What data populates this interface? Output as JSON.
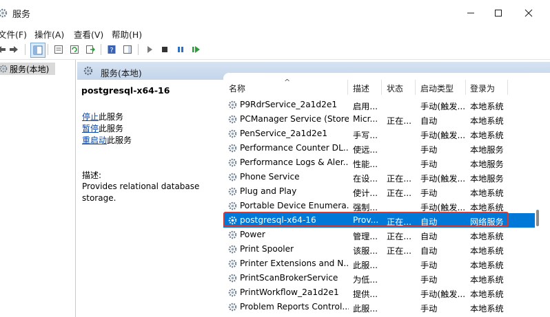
{
  "window": {
    "title": "服务"
  },
  "menu": {
    "file": "文件(F)",
    "action": "操作(A)",
    "view": "查看(V)",
    "help": "帮助(H)"
  },
  "tree": {
    "root_label": "服务(本地)"
  },
  "header": {
    "title": "服务(本地)"
  },
  "detail": {
    "service_name": "postgresql-x64-16",
    "stop_link": "停止",
    "stop_suffix": "此服务",
    "pause_link": "暂停",
    "pause_suffix": "此服务",
    "restart_link": "重启动",
    "restart_suffix": "此服务",
    "desc_label": "描述:",
    "desc_text": "Provides relational database storage."
  },
  "columns": {
    "name": "名称",
    "desc": "描述",
    "status": "状态",
    "startup": "启动类型",
    "logon": "登录为"
  },
  "rows": [
    {
      "name": "P9RdrService_2a1d2e1",
      "desc": "启用...",
      "status": "",
      "startup": "手动(触发...",
      "logon": "本地系统"
    },
    {
      "name": "PCManager Service (Store)",
      "desc": "Micr...",
      "status": "正在...",
      "startup": "自动",
      "logon": "本地系统"
    },
    {
      "name": "PenService_2a1d2e1",
      "desc": "手写...",
      "status": "",
      "startup": "手动(触发...",
      "logon": "本地系统"
    },
    {
      "name": "Performance Counter DL...",
      "desc": "使远...",
      "status": "",
      "startup": "手动",
      "logon": "本地服务"
    },
    {
      "name": "Performance Logs & Aler...",
      "desc": "性能...",
      "status": "",
      "startup": "手动",
      "logon": "本地服务"
    },
    {
      "name": "Phone Service",
      "desc": "在设...",
      "status": "正在...",
      "startup": "手动(触发...",
      "logon": "本地服务"
    },
    {
      "name": "Plug and Play",
      "desc": "使计...",
      "status": "正在...",
      "startup": "手动",
      "logon": "本地系统"
    },
    {
      "name": "Portable Device Enumera...",
      "desc": "强制...",
      "status": "",
      "startup": "手动(触发...",
      "logon": "本地系统"
    },
    {
      "name": "postgresql-x64-16",
      "desc": "Prov...",
      "status": "正在...",
      "startup": "自动",
      "logon": "网络服务"
    },
    {
      "name": "Power",
      "desc": "管理...",
      "status": "正在...",
      "startup": "自动",
      "logon": "本地系统"
    },
    {
      "name": "Print Spooler",
      "desc": "该服...",
      "status": "正在...",
      "startup": "自动",
      "logon": "本地系统"
    },
    {
      "name": "Printer Extensions and N...",
      "desc": "此服...",
      "status": "",
      "startup": "手动",
      "logon": "本地系统"
    },
    {
      "name": "PrintScanBrokerService",
      "desc": "为低...",
      "status": "",
      "startup": "手动",
      "logon": "本地系统"
    },
    {
      "name": "PrintWorkflow_2a1d2e1",
      "desc": "提供...",
      "status": "",
      "startup": "手动(触发...",
      "logon": "本地系统"
    },
    {
      "name": "Problem Reports Control...",
      "desc": "此服...",
      "status": "",
      "startup": "手动",
      "logon": "本地系统"
    }
  ],
  "selected_row": "postgresql-x64-16",
  "colors": {
    "selection": "#0078d7",
    "highlight_outline": "#e0372b",
    "header_bg": "#c4d5ea",
    "link": "#0645ad"
  }
}
